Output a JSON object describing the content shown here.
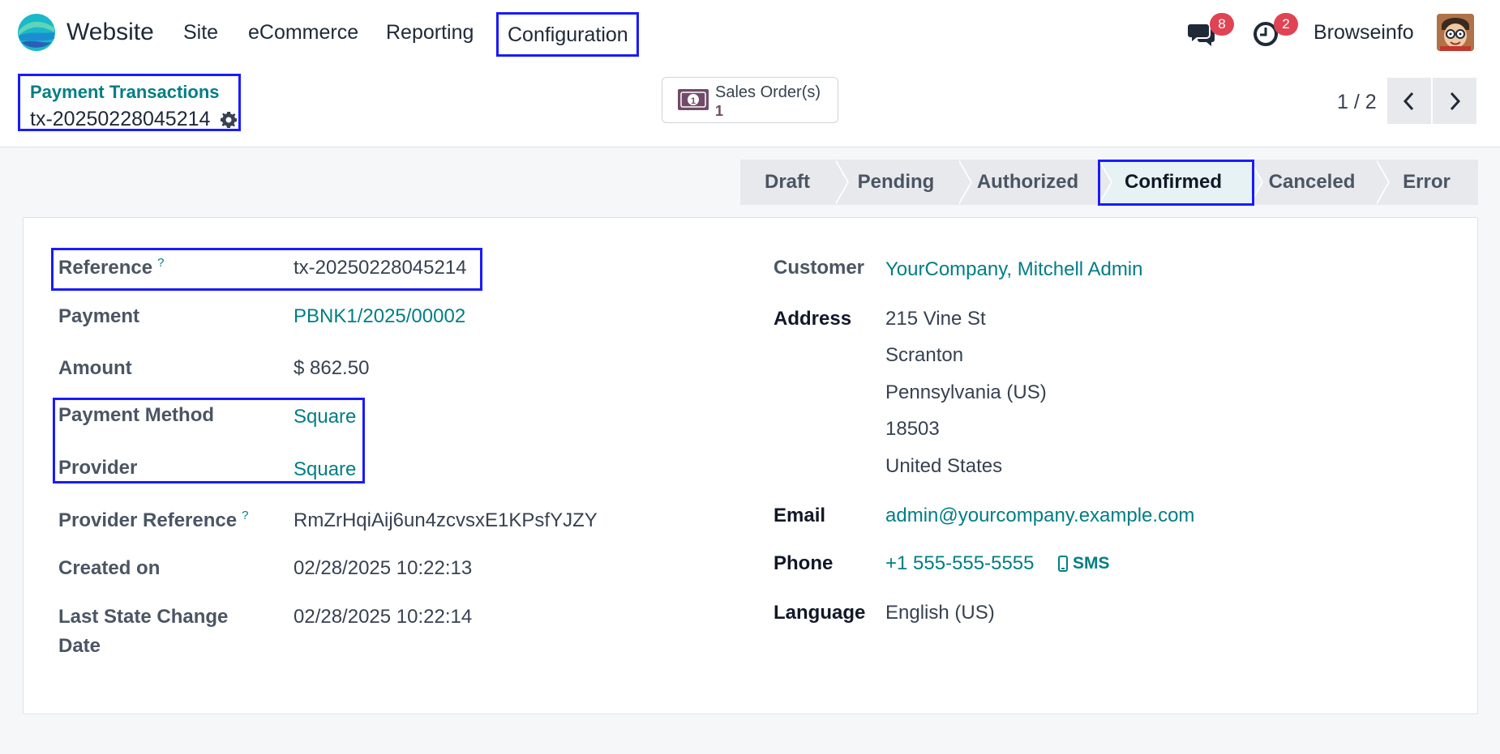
{
  "navbar": {
    "app_name": "Website",
    "menu": [
      "Site",
      "eCommerce",
      "Reporting",
      "Configuration"
    ],
    "messages_count": "8",
    "activities_count": "2",
    "user_name": "Browseinfo"
  },
  "breadcrumb": {
    "parent": "Payment Transactions",
    "current": "tx-20250228045214"
  },
  "smart_button": {
    "label": "Sales Order(s)",
    "value": "1"
  },
  "pager": {
    "value": "1 / 2"
  },
  "statusbar": {
    "steps": [
      "Draft",
      "Pending",
      "Authorized",
      "Confirmed",
      "Canceled",
      "Error"
    ],
    "active": "Confirmed"
  },
  "form": {
    "left": {
      "reference_label": "Reference",
      "reference_help": "?",
      "reference_value": "tx-20250228045214",
      "payment_label": "Payment",
      "payment_value": "PBNK1/2025/00002",
      "amount_label": "Amount",
      "amount_value": "$ 862.50",
      "payment_method_label": "Payment Method",
      "payment_method_value": "Square",
      "provider_label": "Provider",
      "provider_value": "Square",
      "provider_ref_label": "Provider Reference",
      "provider_ref_help": "?",
      "provider_ref_value": "RmZrHqiAij6un4zcvsxE1KPsfYJZY",
      "created_label": "Created on",
      "created_value": "02/28/2025 10:22:13",
      "last_state_label_1": "Last State Change",
      "last_state_label_2": "Date",
      "last_state_value": "02/28/2025 10:22:14"
    },
    "right": {
      "customer_label": "Customer",
      "customer_value": "YourCompany, Mitchell Admin",
      "address_label": "Address",
      "address_lines": [
        "215 Vine St",
        "Scranton",
        "Pennsylvania (US)",
        "18503",
        "United States"
      ],
      "email_label": "Email",
      "email_value": "admin@yourcompany.example.com",
      "phone_label": "Phone",
      "phone_value": "+1 555-555-5555",
      "sms_label": "SMS",
      "language_label": "Language",
      "language_value": "English (US)"
    }
  },
  "colors": {
    "accent_link": "#017e84",
    "highlight_box": "#1a1aff",
    "badge": "#e04454",
    "smart_value": "#714b67"
  }
}
